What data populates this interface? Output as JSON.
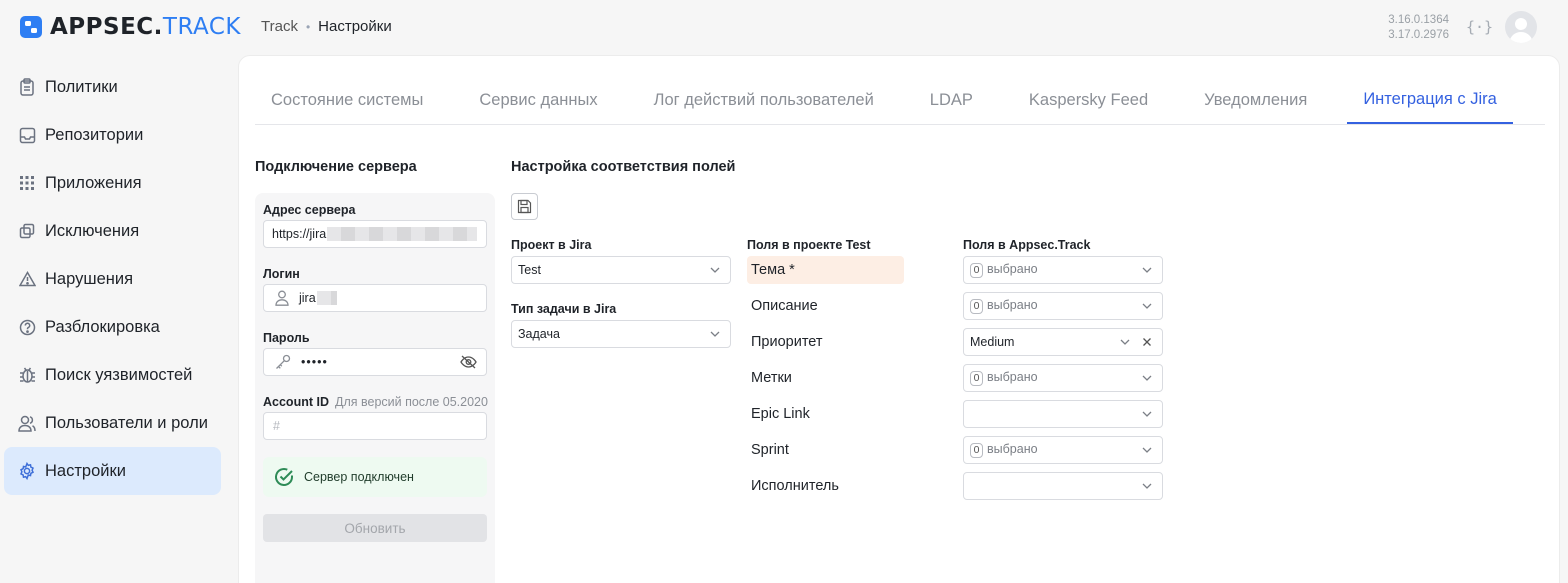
{
  "app": {
    "logo_main": "APPSEC.",
    "logo_accent": "TRACK",
    "brand_color": "#2e7ef3"
  },
  "breadcrumb": {
    "root": "Track",
    "current": "Настройки"
  },
  "versions": {
    "line1": "3.16.0.1364",
    "line2": "3.17.0.2976"
  },
  "sidebar": {
    "items": [
      {
        "label": "Политики",
        "icon": "clipboard-icon"
      },
      {
        "label": "Репозитории",
        "icon": "inbox-icon"
      },
      {
        "label": "Приложения",
        "icon": "grid-icon"
      },
      {
        "label": "Исключения",
        "icon": "copy-icon"
      },
      {
        "label": "Нарушения",
        "icon": "warning-icon"
      },
      {
        "label": "Разблокировка",
        "icon": "question-icon"
      },
      {
        "label": "Поиск уязвимостей",
        "icon": "bug-icon"
      },
      {
        "label": "Пользователи и роли",
        "icon": "users-icon"
      },
      {
        "label": "Настройки",
        "icon": "gear-icon",
        "active": true
      }
    ]
  },
  "tabs": [
    {
      "label": "Состояние системы"
    },
    {
      "label": "Сервис данных"
    },
    {
      "label": "Лог действий пользователей"
    },
    {
      "label": "LDAP"
    },
    {
      "label": "Kaspersky Feed"
    },
    {
      "label": "Уведомления"
    },
    {
      "label": "Интеграция с Jira",
      "active": true
    }
  ],
  "server": {
    "title": "Подключение сервера",
    "address_label": "Адрес сервера",
    "address_value": "https://jira",
    "login_label": "Логин",
    "login_value": "jira",
    "password_label": "Пароль",
    "password_value": "•••••",
    "account_label": "Account ID",
    "account_note": "Для версий после 05.2020",
    "account_placeholder": "#",
    "status": "Сервер подключен",
    "update_button": "Обновить"
  },
  "mapping": {
    "title": "Настройка соответствия полей",
    "project_label": "Проект в Jira",
    "project_value": "Test",
    "issue_type_label": "Тип задачи в Jira",
    "issue_type_value": "Задача",
    "jira_fields_header": "Поля в проекте Test",
    "appsec_fields_header": "Поля в Appsec.Track",
    "rows": [
      {
        "jira": "Тема *",
        "count": "0",
        "value": "выбрано"
      },
      {
        "jira": "Описание",
        "count": "0",
        "value": "выбрано"
      },
      {
        "jira": "Приоритет",
        "value": "Medium"
      },
      {
        "jira": "Метки",
        "count": "0",
        "value": "выбрано"
      },
      {
        "jira": "Epic Link",
        "value": ""
      },
      {
        "jira": "Sprint",
        "count": "0",
        "value": "выбрано"
      },
      {
        "jira": "Исполнитель",
        "value": ""
      }
    ]
  }
}
